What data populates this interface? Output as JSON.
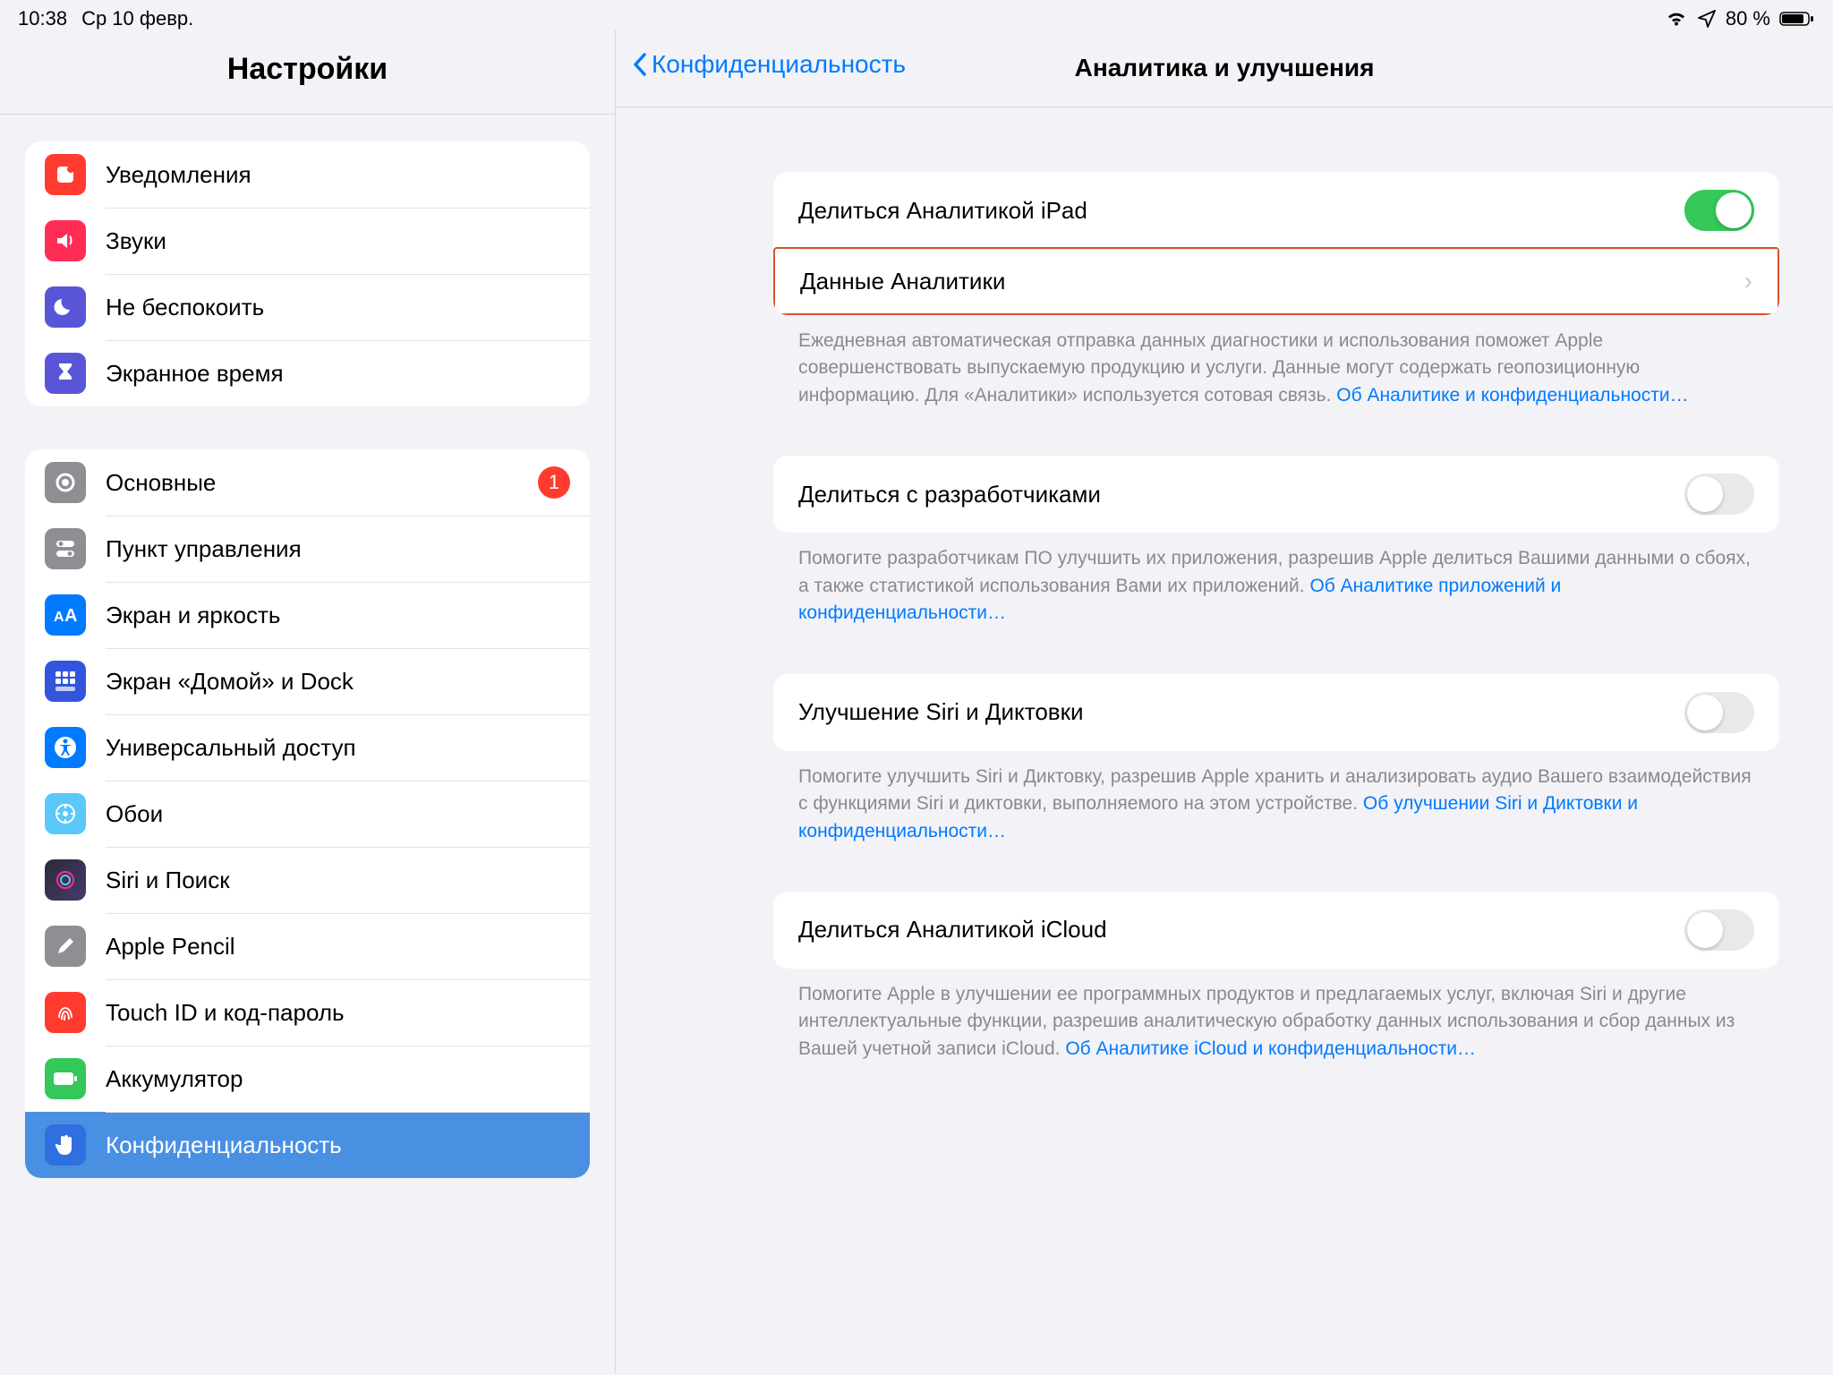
{
  "statusbar": {
    "time": "10:38",
    "date": "Ср 10 февр.",
    "battery": "80 %"
  },
  "sidebar": {
    "title": "Настройки",
    "group1": [
      {
        "label": "Уведомления"
      },
      {
        "label": "Звуки"
      },
      {
        "label": "Не беспокоить"
      },
      {
        "label": "Экранное время"
      }
    ],
    "group2": [
      {
        "label": "Основные",
        "badge": "1"
      },
      {
        "label": "Пункт управления"
      },
      {
        "label": "Экран и яркость"
      },
      {
        "label": "Экран «Домой» и Dock"
      },
      {
        "label": "Универсальный доступ"
      },
      {
        "label": "Обои"
      },
      {
        "label": "Siri и Поиск"
      },
      {
        "label": "Apple Pencil"
      },
      {
        "label": "Touch ID и код-пароль"
      },
      {
        "label": "Аккумулятор"
      },
      {
        "label": "Конфиденциальность"
      }
    ]
  },
  "content": {
    "back": "Конфиденциальность",
    "title": "Аналитика и улучшения",
    "s1": {
      "share_label": "Делиться Аналитикой iPad",
      "data_label": "Данные Аналитики",
      "note": "Ежедневная автоматическая отправка данных диагностики и использования поможет Apple совершенствовать выпускаемую продукцию и услуги. Данные могут содержать геопозиционную информацию. Для «Аналитики» используется сотовая связь. ",
      "link": "Об Аналитике и конфиденциальности…"
    },
    "s2": {
      "label": "Делиться с разработчиками",
      "note": "Помогите разработчикам ПО улучшить их приложения, разрешив Apple делиться Вашими данными о сбоях, а также статистикой использования Вами их приложений. ",
      "link": "Об Аналитике приложений и конфиденциальности…"
    },
    "s3": {
      "label": "Улучшение Siri и Диктовки",
      "note": "Помогите улучшить Siri и Диктовку, разрешив Apple хранить и анализировать аудио Вашего взаимодействия с функциями Siri и диктовки, выполняемого на этом устройстве. ",
      "link": "Об улучшении Siri и Диктовки и конфиденциальности…"
    },
    "s4": {
      "label": "Делиться Аналитикой iCloud",
      "note": "Помогите Apple в улучшении ее программных продуктов и предлагаемых услуг, включая Siri и другие интеллектуальные функции, разрешив аналитическую обработку данных использования и сбор данных из Вашей учетной записи iCloud. ",
      "link": "Об Аналитике iCloud и конфиденциальности…"
    }
  }
}
